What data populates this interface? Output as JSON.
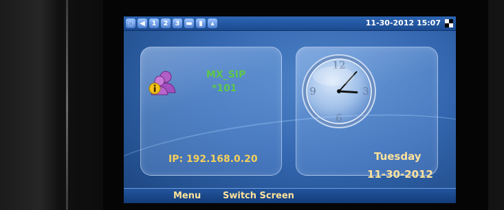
{
  "status_bar": {
    "icons": [
      {
        "name": "network-icon",
        "glyph": "◌"
      },
      {
        "name": "volume-icon",
        "glyph": "◀"
      },
      {
        "name": "line1-icon",
        "glyph": "1"
      },
      {
        "name": "line2-icon",
        "glyph": "2"
      },
      {
        "name": "line3-icon",
        "glyph": "3"
      },
      {
        "name": "drawer-icon",
        "glyph": "▬"
      },
      {
        "name": "battery-icon",
        "glyph": "▮"
      },
      {
        "name": "lock-icon",
        "glyph": "▴"
      }
    ],
    "datetime": "11-30-2012 15:07",
    "colors": {
      "bar": "#2d66b3",
      "text": "#ffffff"
    }
  },
  "account_panel": {
    "icon": "user-info-icon",
    "account_name": "MX_SIP",
    "extension": "*101",
    "ip": "IP: 192.168.0.20",
    "colors": {
      "name": "#5cc84a",
      "ip": "#f4d05a"
    }
  },
  "clock_panel": {
    "numerals": {
      "twelve": "12",
      "three": "3",
      "six": "6",
      "nine": "9"
    },
    "time": {
      "hour": 15,
      "minute": 7
    },
    "day": "Tuesday",
    "date": "11-30-2012",
    "colors": {
      "text": "#ffe39a"
    }
  },
  "softkeys": {
    "menu": "Menu",
    "switch_screen": "Switch Screen"
  }
}
